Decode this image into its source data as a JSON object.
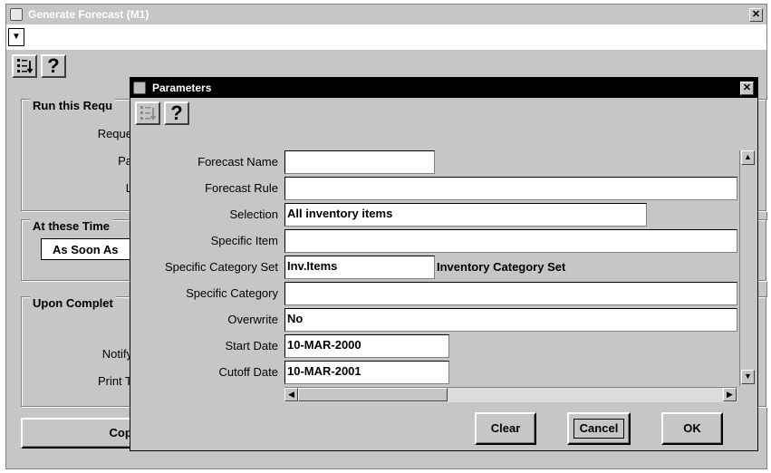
{
  "main_window": {
    "title": "Generate Forecast (M1)",
    "close_glyph": "✕",
    "dropdown_glyph": "▼",
    "help_glyph": "?",
    "groups": {
      "run_request": {
        "title": "Run this Requ",
        "labels": [
          "Reque",
          "Pa",
          "L"
        ]
      },
      "at_these_times": {
        "title": "At these Time",
        "value": "As Soon As"
      },
      "upon_completion": {
        "title": "Upon Complet",
        "labels": [
          "Notify",
          "Print T"
        ]
      }
    },
    "copy_button": "Copy"
  },
  "dialog": {
    "title": "Parameters",
    "close_glyph": "✕",
    "help_glyph": "?",
    "fields": [
      {
        "label": "Forecast Name",
        "value": ""
      },
      {
        "label": "Forecast Rule",
        "value": ""
      },
      {
        "label": "Selection",
        "value": "All inventory items"
      },
      {
        "label": "Specific Item",
        "value": ""
      },
      {
        "label": "Specific Category Set",
        "value": "Inv.Items",
        "description": "Inventory Category Set"
      },
      {
        "label": "Specific Category",
        "value": ""
      },
      {
        "label": "Overwrite",
        "value": "No"
      },
      {
        "label": "Start Date",
        "value": "10-MAR-2000"
      },
      {
        "label": "Cutoff Date",
        "value": "10-MAR-2001"
      }
    ],
    "scroll_glyphs": {
      "up": "▲",
      "down": "▼",
      "left": "◀",
      "right": "▶"
    },
    "buttons": {
      "clear": "Clear",
      "cancel": "Cancel",
      "ok": "OK"
    }
  }
}
